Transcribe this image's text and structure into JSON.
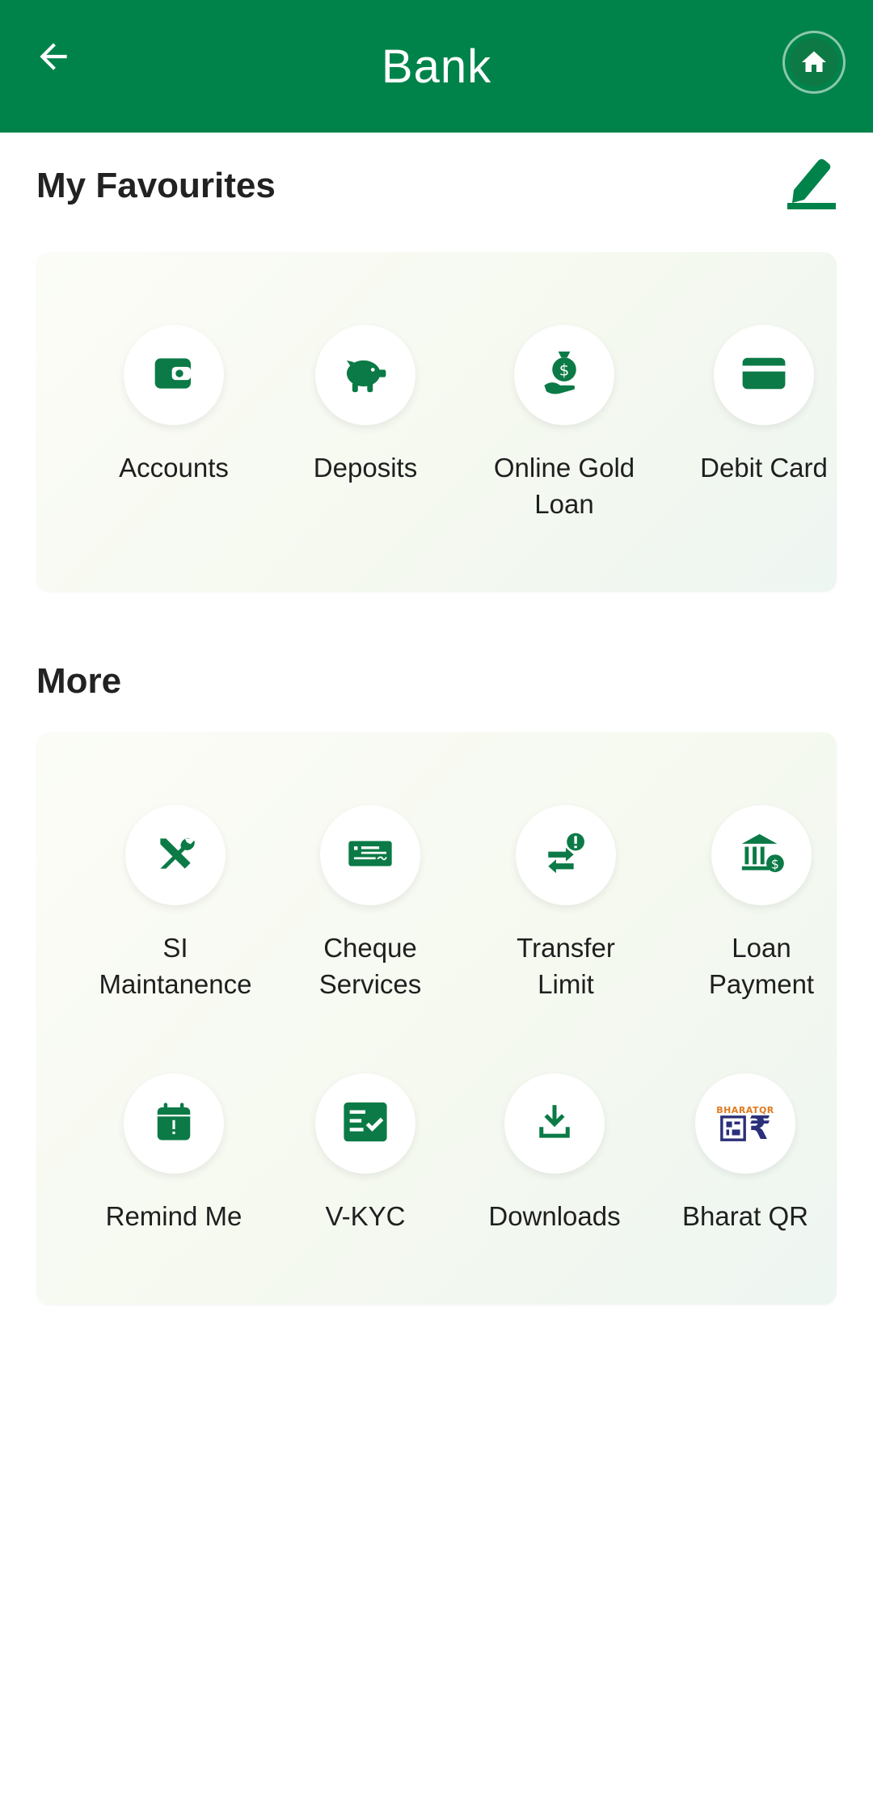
{
  "header": {
    "title": "Bank",
    "back_icon": "arrow-left-icon",
    "home_icon": "home-icon"
  },
  "favourites": {
    "title": "My Favourites",
    "edit_icon": "pencil-icon",
    "items": [
      {
        "label": "Accounts",
        "icon": "wallet-icon"
      },
      {
        "label": "Deposits",
        "icon": "piggy-bank-icon"
      },
      {
        "label": "Online Gold\nLoan",
        "icon": "money-bag-hand-icon"
      },
      {
        "label": "Debit Card",
        "icon": "card-icon"
      }
    ]
  },
  "more": {
    "title": "More",
    "items": [
      {
        "label": "SI\nMaintanence",
        "icon": "tools-icon"
      },
      {
        "label": "Cheque\nServices",
        "icon": "cheque-icon"
      },
      {
        "label": "Transfer\nLimit",
        "icon": "transfer-limit-icon"
      },
      {
        "label": "Loan\nPayment",
        "icon": "bank-building-icon"
      },
      {
        "label": "Remind Me",
        "icon": "calendar-alert-icon"
      },
      {
        "label": "V-KYC",
        "icon": "checklist-icon"
      },
      {
        "label": "Downloads",
        "icon": "download-icon"
      },
      {
        "label": "Bharat QR",
        "icon": "bharat-qr-icon",
        "logo_text_top": "BHARATQR",
        "logo_text_symbol": "₹"
      }
    ]
  },
  "colors": {
    "primary": "#00834a",
    "icon": "#0b7a46",
    "bharat_qr_orange": "#e07a1f",
    "bharat_qr_navy": "#2b2f7a"
  }
}
